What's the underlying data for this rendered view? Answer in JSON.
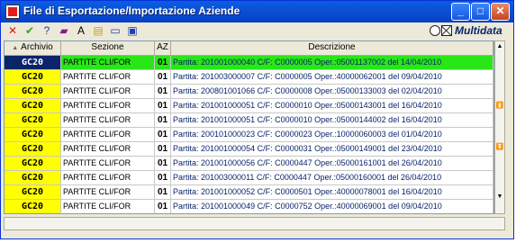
{
  "window": {
    "title": "File di Esportazione/Importazione Aziende"
  },
  "toolbar": {
    "tools": [
      {
        "name": "delete-icon",
        "glyph": "✕",
        "color": "#d61a1a"
      },
      {
        "name": "check-icon",
        "glyph": "✔",
        "color": "#2ea22e"
      },
      {
        "name": "help-icon",
        "glyph": "?",
        "color": "#1c3fb0"
      },
      {
        "name": "book-icon",
        "glyph": "▰",
        "color": "#8b1a8b"
      },
      {
        "name": "text-icon",
        "glyph": "A",
        "color": "#000000"
      },
      {
        "name": "image-icon",
        "glyph": "▤",
        "color": "#c8a020"
      },
      {
        "name": "window-icon",
        "glyph": "▭",
        "color": "#1c3fb0"
      },
      {
        "name": "export-icon",
        "glyph": "▣",
        "color": "#1c3fb0"
      }
    ],
    "brand": "Multidata"
  },
  "table": {
    "headers": {
      "archivio": "Archivio",
      "sezione": "Sezione",
      "az": "AZ",
      "descrizione": "Descrizione"
    },
    "rows": [
      {
        "archivio": "GC20",
        "sezione": "PARTITE CLI/FOR",
        "az": "01",
        "descrizione": "Partita: 201001000040 C/F: C0000005 Oper.:05001137002 del 14/04/2010",
        "selected": true
      },
      {
        "archivio": "GC20",
        "sezione": "PARTITE CLI/FOR",
        "az": "01",
        "descrizione": "Partita: 201003000007 C/F: C0000005 Oper.:40000062001 del 09/04/2010"
      },
      {
        "archivio": "GC20",
        "sezione": "PARTITE CLI/FOR",
        "az": "01",
        "descrizione": "Partita: 200801001066 C/F: C0000008 Oper.:05000133003 del 02/04/2010"
      },
      {
        "archivio": "GC20",
        "sezione": "PARTITE CLI/FOR",
        "az": "01",
        "descrizione": "Partita: 201001000051 C/F: C0000010 Oper.:05000143001 del 16/04/2010"
      },
      {
        "archivio": "GC20",
        "sezione": "PARTITE CLI/FOR",
        "az": "01",
        "descrizione": "Partita: 201001000051 C/F: C0000010 Oper.:05000144002 del 16/04/2010"
      },
      {
        "archivio": "GC20",
        "sezione": "PARTITE CLI/FOR",
        "az": "01",
        "descrizione": "Partita: 200101000023 C/F: C0000023 Oper.:10000060003 del 01/04/2010"
      },
      {
        "archivio": "GC20",
        "sezione": "PARTITE CLI/FOR",
        "az": "01",
        "descrizione": "Partita: 201001000054 C/F: C0000031 Oper.:05000149001 del 23/04/2010"
      },
      {
        "archivio": "GC20",
        "sezione": "PARTITE CLI/FOR",
        "az": "01",
        "descrizione": "Partita: 201001000056 C/F: C0000447 Oper.:05000161001 del 26/04/2010"
      },
      {
        "archivio": "GC20",
        "sezione": "PARTITE CLI/FOR",
        "az": "01",
        "descrizione": "Partita: 201003000011 C/F: C0000447 Oper.:05000160001 del 26/04/2010"
      },
      {
        "archivio": "GC20",
        "sezione": "PARTITE CLI/FOR",
        "az": "01",
        "descrizione": "Partita: 201001000052 C/F: C0000501 Oper.:40000078001 del 16/04/2010"
      },
      {
        "archivio": "GC20",
        "sezione": "PARTITE CLI/FOR",
        "az": "01",
        "descrizione": "Partita: 201001000049 C/F: C0000752 Oper.:40000069001 del 09/04/2010"
      }
    ]
  }
}
